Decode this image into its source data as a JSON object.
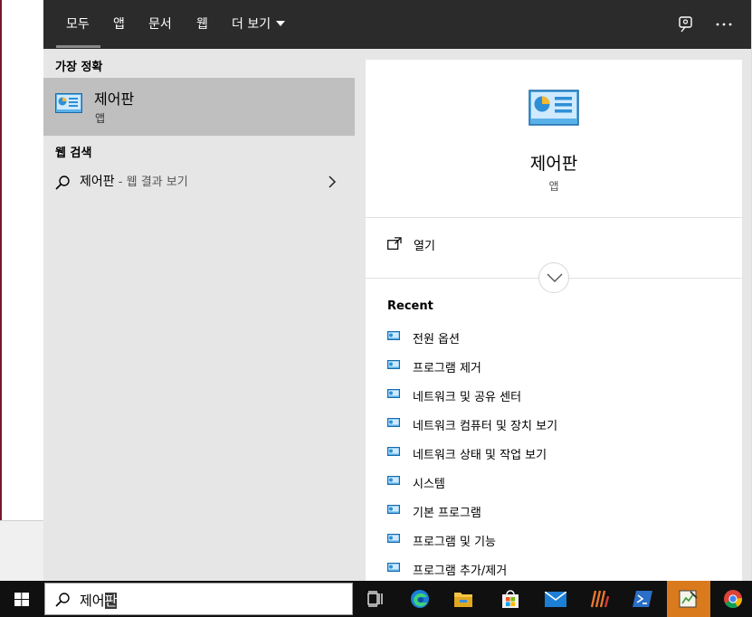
{
  "tabs": [
    {
      "label": "모두",
      "active": true
    },
    {
      "label": "앱"
    },
    {
      "label": "문서"
    },
    {
      "label": "웹"
    },
    {
      "label": "더 보기"
    }
  ],
  "left": {
    "best_match_heading": "가장 정확",
    "best_match": {
      "title": "제어판",
      "subtitle": "앱",
      "icon": "control-panel-icon"
    },
    "web_search_heading": "웹 검색",
    "web_search": {
      "query": "제어판",
      "suffix": " - 웹 결과 보기"
    }
  },
  "detail": {
    "title": "제어판",
    "subtitle": "앱",
    "icon": "control-panel-icon",
    "open_label": "열기",
    "recent_heading": "Recent",
    "recent": [
      "전원 옵션",
      "프로그램 제거",
      "네트워크 및 공유 센터",
      "네트워크 컴퓨터 및 장치 보기",
      "네트워크 상태 및 작업 보기",
      "시스템",
      "기본 프로그램",
      "프로그램 및 기능",
      "프로그램 추가/제거"
    ]
  },
  "search": {
    "typed": "제어",
    "selected": "판"
  },
  "taskbar": {
    "apps": [
      "task-view-icon",
      "edge-icon",
      "file-explorer-icon",
      "store-icon",
      "mail-icon",
      "app-icon",
      "powershell-icon",
      "editor-icon",
      "chrome-icon"
    ]
  },
  "colors": {
    "topbar": "#2b2b2b",
    "panel": "#e6e6e6",
    "selected": "#bfbfbf",
    "taskbar": "#101010"
  }
}
